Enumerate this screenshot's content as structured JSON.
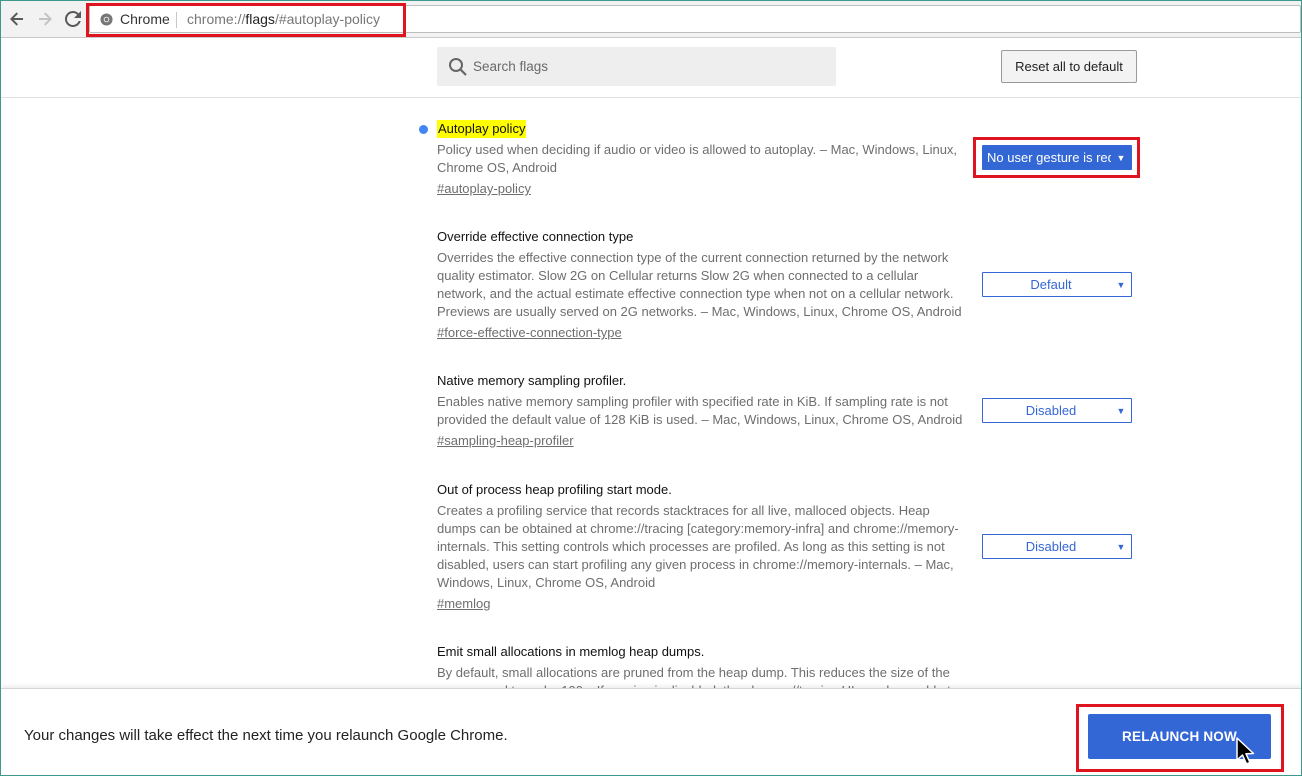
{
  "toolbar": {
    "back_icon": "arrow-left-icon",
    "forward_icon": "arrow-right-icon",
    "reload_icon": "reload-icon",
    "omnibox": {
      "site_label": "Chrome",
      "url_scheme": "chrome://",
      "url_host": "flags",
      "url_path": "/#autoplay-policy"
    }
  },
  "header": {
    "search_placeholder": "Search flags",
    "reset_label": "Reset all to default"
  },
  "experiments": [
    {
      "title": "Autoplay policy",
      "description": "Policy used when deciding if audio or video is allowed to autoplay. – Mac, Windows, Linux, Chrome OS, Android",
      "link": "#autoplay-policy",
      "selected": "No user gesture is required",
      "modified": true
    },
    {
      "title": "Override effective connection type",
      "description": "Overrides the effective connection type of the current connection returned by the network quality estimator. Slow 2G on Cellular returns Slow 2G when connected to a cellular network, and the actual estimate effective connection type when not on a cellular network. Previews are usually served on 2G networks. – Mac, Windows, Linux, Chrome OS, Android",
      "link": "#force-effective-connection-type",
      "selected": "Default"
    },
    {
      "title": "Native memory sampling profiler.",
      "description": "Enables native memory sampling profiler with specified rate in KiB. If sampling rate is not provided the default value of 128 KiB is used. – Mac, Windows, Linux, Chrome OS, Android",
      "link": "#sampling-heap-profiler",
      "selected": "Disabled"
    },
    {
      "title": "Out of process heap profiling start mode.",
      "description": "Creates a profiling service that records stacktraces for all live, malloced objects. Heap dumps can be obtained at chrome://tracing [category:memory-infra] and chrome://memory-internals. This setting controls which processes are profiled. As long as this setting is not disabled, users can start profiling any given process in chrome://memory-internals. – Mac, Windows, Linux, Chrome OS, Android",
      "link": "#memlog",
      "selected": "Disabled"
    },
    {
      "title": "Emit small allocations in memlog heap dumps.",
      "description": "By default, small allocations are pruned from the heap dump. This reduces the size of the compressed trace by 100x. If pruning is disabled, the chrome://tracing UI may be unable to"
    }
  ],
  "bottom_bar": {
    "message": "Your changes will take effect the next time you relaunch Google Chrome.",
    "relaunch_label": "RELAUNCH NOW"
  },
  "colors": {
    "accent": "#3367d6",
    "modified_dot": "#4285f4",
    "highlight": "#ffff00",
    "annotation_red": "#e0141e"
  }
}
